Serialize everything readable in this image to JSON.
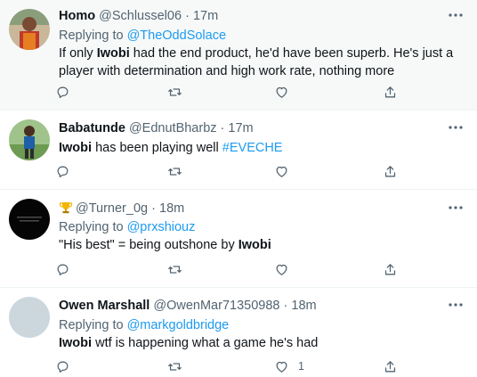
{
  "tweets": [
    {
      "display_name": "Homo",
      "handle": "@Schlussel06",
      "separator": "·",
      "time": "17m",
      "replying_prefix": "Replying to ",
      "replying_to": "@TheOddSolace",
      "text_pre": "If only ",
      "text_bold": "Iwobi",
      "text_post": " had the end product, he'd have been superb. He's just a player with determination and high work rate, nothing more",
      "like_count": ""
    },
    {
      "display_name": "Babatunde",
      "handle": "@EdnutBharbz",
      "separator": "·",
      "time": "17m",
      "text_bold": "Iwobi",
      "text_post": " has been playing well ",
      "hashtag": "#EVECHE",
      "like_count": ""
    },
    {
      "display_name": "",
      "handle": "@Turner_0g",
      "separator": "·",
      "time": "18m",
      "replying_prefix": "Replying to ",
      "replying_to": "@prxshiouz",
      "text_pre": "\"His best\" = being outshone by ",
      "text_bold": "Iwobi",
      "like_count": ""
    },
    {
      "display_name": "Owen Marshall",
      "handle": "@OwenMar71350988",
      "separator": "·",
      "time": "18m",
      "replying_prefix": "Replying to ",
      "replying_to": "@markgoldbridge",
      "text_bold": "Iwobi",
      "text_post": " wtf is happening what a game he's had",
      "like_count": "1"
    }
  ],
  "icons": {
    "reply": "reply-icon",
    "retweet": "retweet-icon",
    "like": "heart-icon",
    "share": "share-icon",
    "more": "more-icon",
    "trophy": "trophy-icon"
  },
  "colors": {
    "link": "#1d9bf0",
    "secondary_text": "#536471",
    "primary_text": "#0f1419",
    "hover_background": "#f7f9f9",
    "divider": "#eff3f4",
    "trophy": "#f4b400"
  }
}
